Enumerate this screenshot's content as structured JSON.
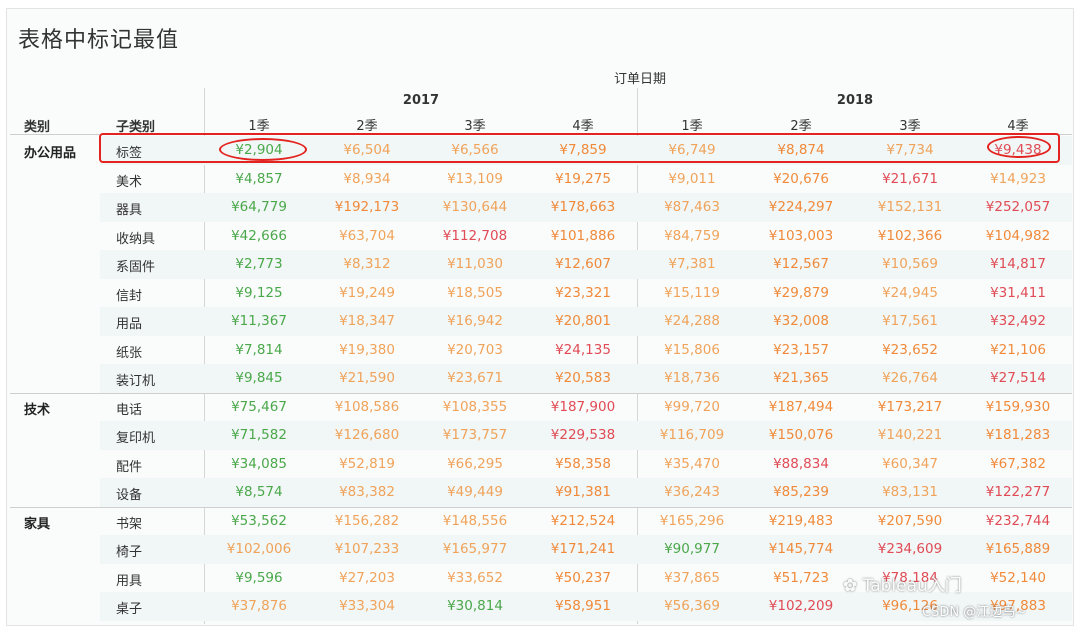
{
  "title": "表格中标记最值",
  "header": {
    "date_label": "订单日期",
    "category_label": "类别",
    "subcategory_label": "子类别",
    "years": [
      "2017",
      "2018"
    ],
    "quarters": [
      "1季",
      "2季",
      "3季",
      "4季",
      "1季",
      "2季",
      "3季",
      "4季"
    ]
  },
  "categories": [
    {
      "name": "办公用品",
      "rows": [
        {
          "sub": "标签",
          "values": [
            "¥2,904",
            "¥6,504",
            "¥6,566",
            "¥7,859",
            "¥6,749",
            "¥8,874",
            "¥7,734",
            "¥9,438"
          ],
          "levels": [
            "min",
            "low",
            "low",
            "mid",
            "low",
            "mid",
            "low",
            "high"
          ]
        },
        {
          "sub": "美术",
          "values": [
            "¥4,857",
            "¥8,934",
            "¥13,109",
            "¥19,275",
            "¥9,011",
            "¥20,676",
            "¥21,671",
            "¥14,923"
          ],
          "levels": [
            "min",
            "low",
            "low",
            "mid",
            "low",
            "mid",
            "high",
            "low"
          ]
        },
        {
          "sub": "器具",
          "values": [
            "¥64,779",
            "¥192,173",
            "¥130,644",
            "¥178,663",
            "¥87,463",
            "¥224,297",
            "¥152,131",
            "¥252,057"
          ],
          "levels": [
            "min",
            "mid",
            "low",
            "mid",
            "low",
            "mid",
            "low",
            "high"
          ]
        },
        {
          "sub": "收纳具",
          "values": [
            "¥42,666",
            "¥63,704",
            "¥112,708",
            "¥101,886",
            "¥84,759",
            "¥103,003",
            "¥102,366",
            "¥104,982"
          ],
          "levels": [
            "min",
            "low",
            "high",
            "mid",
            "low",
            "mid",
            "mid",
            "mid"
          ]
        },
        {
          "sub": "系固件",
          "values": [
            "¥2,773",
            "¥8,312",
            "¥11,030",
            "¥12,607",
            "¥7,381",
            "¥12,567",
            "¥10,569",
            "¥14,817"
          ],
          "levels": [
            "min",
            "low",
            "low",
            "mid",
            "low",
            "mid",
            "low",
            "high"
          ]
        },
        {
          "sub": "信封",
          "values": [
            "¥9,125",
            "¥19,249",
            "¥18,505",
            "¥23,321",
            "¥15,119",
            "¥29,879",
            "¥24,945",
            "¥31,411"
          ],
          "levels": [
            "min",
            "low",
            "low",
            "mid",
            "low",
            "mid",
            "low",
            "high"
          ]
        },
        {
          "sub": "用品",
          "values": [
            "¥11,367",
            "¥18,347",
            "¥16,942",
            "¥20,801",
            "¥24,288",
            "¥32,008",
            "¥17,561",
            "¥32,492"
          ],
          "levels": [
            "min",
            "low",
            "low",
            "mid",
            "low",
            "mid",
            "low",
            "high"
          ]
        },
        {
          "sub": "纸张",
          "values": [
            "¥7,814",
            "¥19,380",
            "¥20,703",
            "¥24,135",
            "¥15,806",
            "¥23,157",
            "¥23,652",
            "¥21,106"
          ],
          "levels": [
            "min",
            "low",
            "low",
            "high",
            "low",
            "mid",
            "mid",
            "mid"
          ]
        },
        {
          "sub": "装订机",
          "values": [
            "¥9,845",
            "¥21,590",
            "¥23,671",
            "¥20,583",
            "¥18,736",
            "¥21,365",
            "¥26,764",
            "¥27,514"
          ],
          "levels": [
            "min",
            "low",
            "low",
            "mid",
            "low",
            "mid",
            "low",
            "high"
          ]
        }
      ]
    },
    {
      "name": "技术",
      "rows": [
        {
          "sub": "电话",
          "values": [
            "¥75,467",
            "¥108,586",
            "¥108,355",
            "¥187,900",
            "¥99,720",
            "¥187,494",
            "¥173,217",
            "¥159,930"
          ],
          "levels": [
            "min",
            "low",
            "low",
            "high",
            "low",
            "mid",
            "mid",
            "mid"
          ]
        },
        {
          "sub": "复印机",
          "values": [
            "¥71,582",
            "¥126,680",
            "¥173,757",
            "¥229,538",
            "¥116,709",
            "¥150,076",
            "¥140,221",
            "¥181,283"
          ],
          "levels": [
            "min",
            "low",
            "low",
            "high",
            "low",
            "mid",
            "low",
            "mid"
          ]
        },
        {
          "sub": "配件",
          "values": [
            "¥34,085",
            "¥52,819",
            "¥66,295",
            "¥58,358",
            "¥35,470",
            "¥88,834",
            "¥60,347",
            "¥67,382"
          ],
          "levels": [
            "min",
            "low",
            "low",
            "mid",
            "low",
            "high",
            "low",
            "mid"
          ]
        },
        {
          "sub": "设备",
          "values": [
            "¥8,574",
            "¥83,382",
            "¥49,449",
            "¥91,381",
            "¥36,243",
            "¥85,239",
            "¥83,131",
            "¥122,277"
          ],
          "levels": [
            "min",
            "low",
            "low",
            "mid",
            "low",
            "mid",
            "low",
            "high"
          ]
        }
      ]
    },
    {
      "name": "家具",
      "rows": [
        {
          "sub": "书架",
          "values": [
            "¥53,562",
            "¥156,282",
            "¥148,556",
            "¥212,524",
            "¥165,296",
            "¥219,483",
            "¥207,590",
            "¥232,744"
          ],
          "levels": [
            "min",
            "low",
            "low",
            "mid",
            "low",
            "mid",
            "mid",
            "high"
          ]
        },
        {
          "sub": "椅子",
          "values": [
            "¥102,006",
            "¥107,233",
            "¥165,977",
            "¥171,241",
            "¥90,977",
            "¥145,774",
            "¥234,609",
            "¥165,889"
          ],
          "levels": [
            "low",
            "low",
            "low",
            "mid",
            "min",
            "mid",
            "high",
            "mid"
          ]
        },
        {
          "sub": "用具",
          "values": [
            "¥9,596",
            "¥27,203",
            "¥33,652",
            "¥50,237",
            "¥37,865",
            "¥51,723",
            "¥78,184",
            "¥52,140"
          ],
          "levels": [
            "min",
            "low",
            "low",
            "mid",
            "low",
            "mid",
            "high",
            "mid"
          ]
        },
        {
          "sub": "桌子",
          "values": [
            "¥37,876",
            "¥33,304",
            "¥30,814",
            "¥58,951",
            "¥56,369",
            "¥102,209",
            "¥96,126",
            "¥97,883"
          ],
          "levels": [
            "low",
            "low",
            "min",
            "mid",
            "low",
            "high",
            "mid",
            "mid"
          ]
        }
      ]
    }
  ],
  "watermark": {
    "line1": "Tableau入门",
    "line2": "CSDN @江边鸟~"
  },
  "colors": {
    "min": "#4aa84a",
    "low": "#f0a35a",
    "mid": "#f08a3a",
    "high": "#e04b55",
    "highlight": "#e3231f"
  }
}
